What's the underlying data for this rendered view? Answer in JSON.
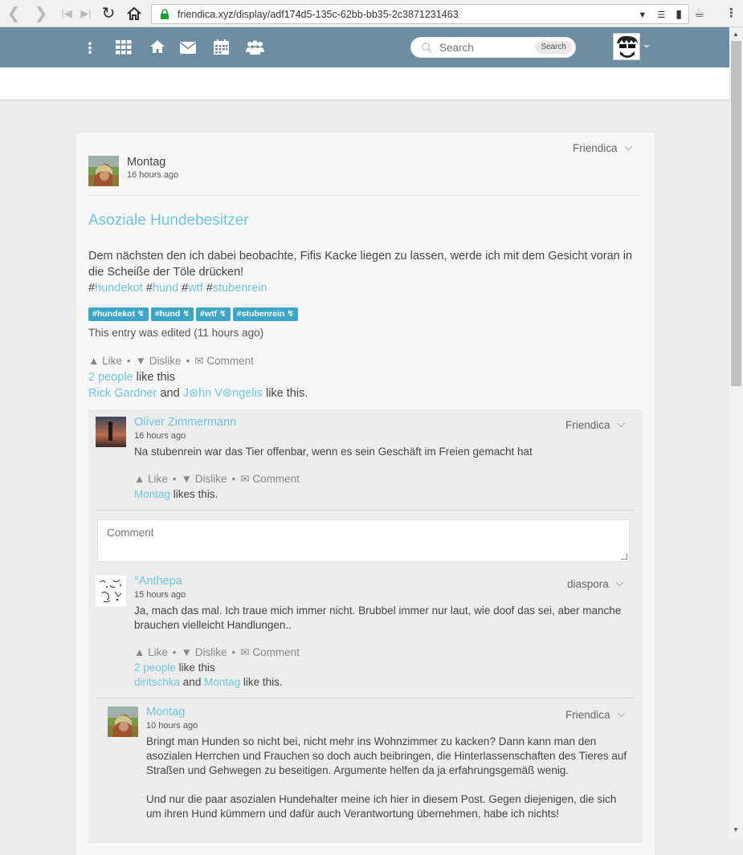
{
  "browser": {
    "url": "friendica.xyz/display/adf174d5-135c-62bb-bb35-2c3871231463"
  },
  "topnav": {
    "search_placeholder": "Search",
    "search_button": "Search"
  },
  "post": {
    "author": "Montag",
    "time": "16 hours ago",
    "network": "Friendica",
    "title": "Asoziale Hundebesitzer",
    "body_line1": "Dem nächsten den ich dabei beobachte, Fifis Kacke liegen zu lassen, werde ich mit dem Gesicht voran in",
    "body_line2": "die Scheiße der Töle drücken!",
    "hashtags": [
      "hundekot",
      "hund",
      "wtf",
      "stubenrein"
    ],
    "tag_chips": [
      "#hundekot",
      "#hund",
      "#wtf",
      "#stubenrein"
    ],
    "edited": "This entry was edited (11 hours ago)",
    "actions": {
      "like": "Like",
      "dislike": "Dislike",
      "comment": "Comment"
    },
    "likes_count": "2 people",
    "likes_suffix": "like this",
    "liker1": "Rick Gardner",
    "and": "and",
    "liker2": "J⊛hn V⊛ngelis",
    "likes_end": "like this."
  },
  "comments": [
    {
      "author": "Oliver Zimmermann",
      "time": "16 hours ago",
      "network": "Friendica",
      "text": "Na stubenrein war das Tier offenbar, wenn es sein Geschäft im Freien gemacht hat",
      "liker": "Montag",
      "likes_suffix": "likes this."
    },
    {
      "author": "°Anthepa",
      "time": "15 hours ago",
      "network": "diaspora",
      "text_line1": "Ja, mach das mal. Ich traue mich immer nicht. Brubbel immer nur laut, wie doof das sei, aber manche",
      "text_line2": "brauchen vielleicht Handlungen..",
      "likes_count": "2 people",
      "likes_suffix": "like this",
      "liker1": "diritschka",
      "and": "and",
      "liker2": "Montag",
      "likes_end": "like this."
    },
    {
      "author": "Montag",
      "time": "10 hours ago",
      "network": "Friendica",
      "p1_line1": "Bringt man Hunden so nicht bei, nicht mehr ins Wohnzimmer zu kacken? Dann kann man den",
      "p1_line2": "asozialen Herrchen und Frauchen so doch auch beibringen, die Hinterlassenschaften des Tieres auf",
      "p1_line3": "Straßen und Gehwegen zu beseitigen. Argumente helfen da ja erfahrungsgemäß wenig.",
      "p2_line1": "Und nur die paar asozialen Hundehalter meine ich hier in diesem Post. Gegen diejenigen, die sich",
      "p2_line2": "um ihren Hund kümmern und dafür auch Verantwortung übernehmen, habe ich nichts!"
    }
  ],
  "comment_box": {
    "placeholder": "Comment"
  }
}
